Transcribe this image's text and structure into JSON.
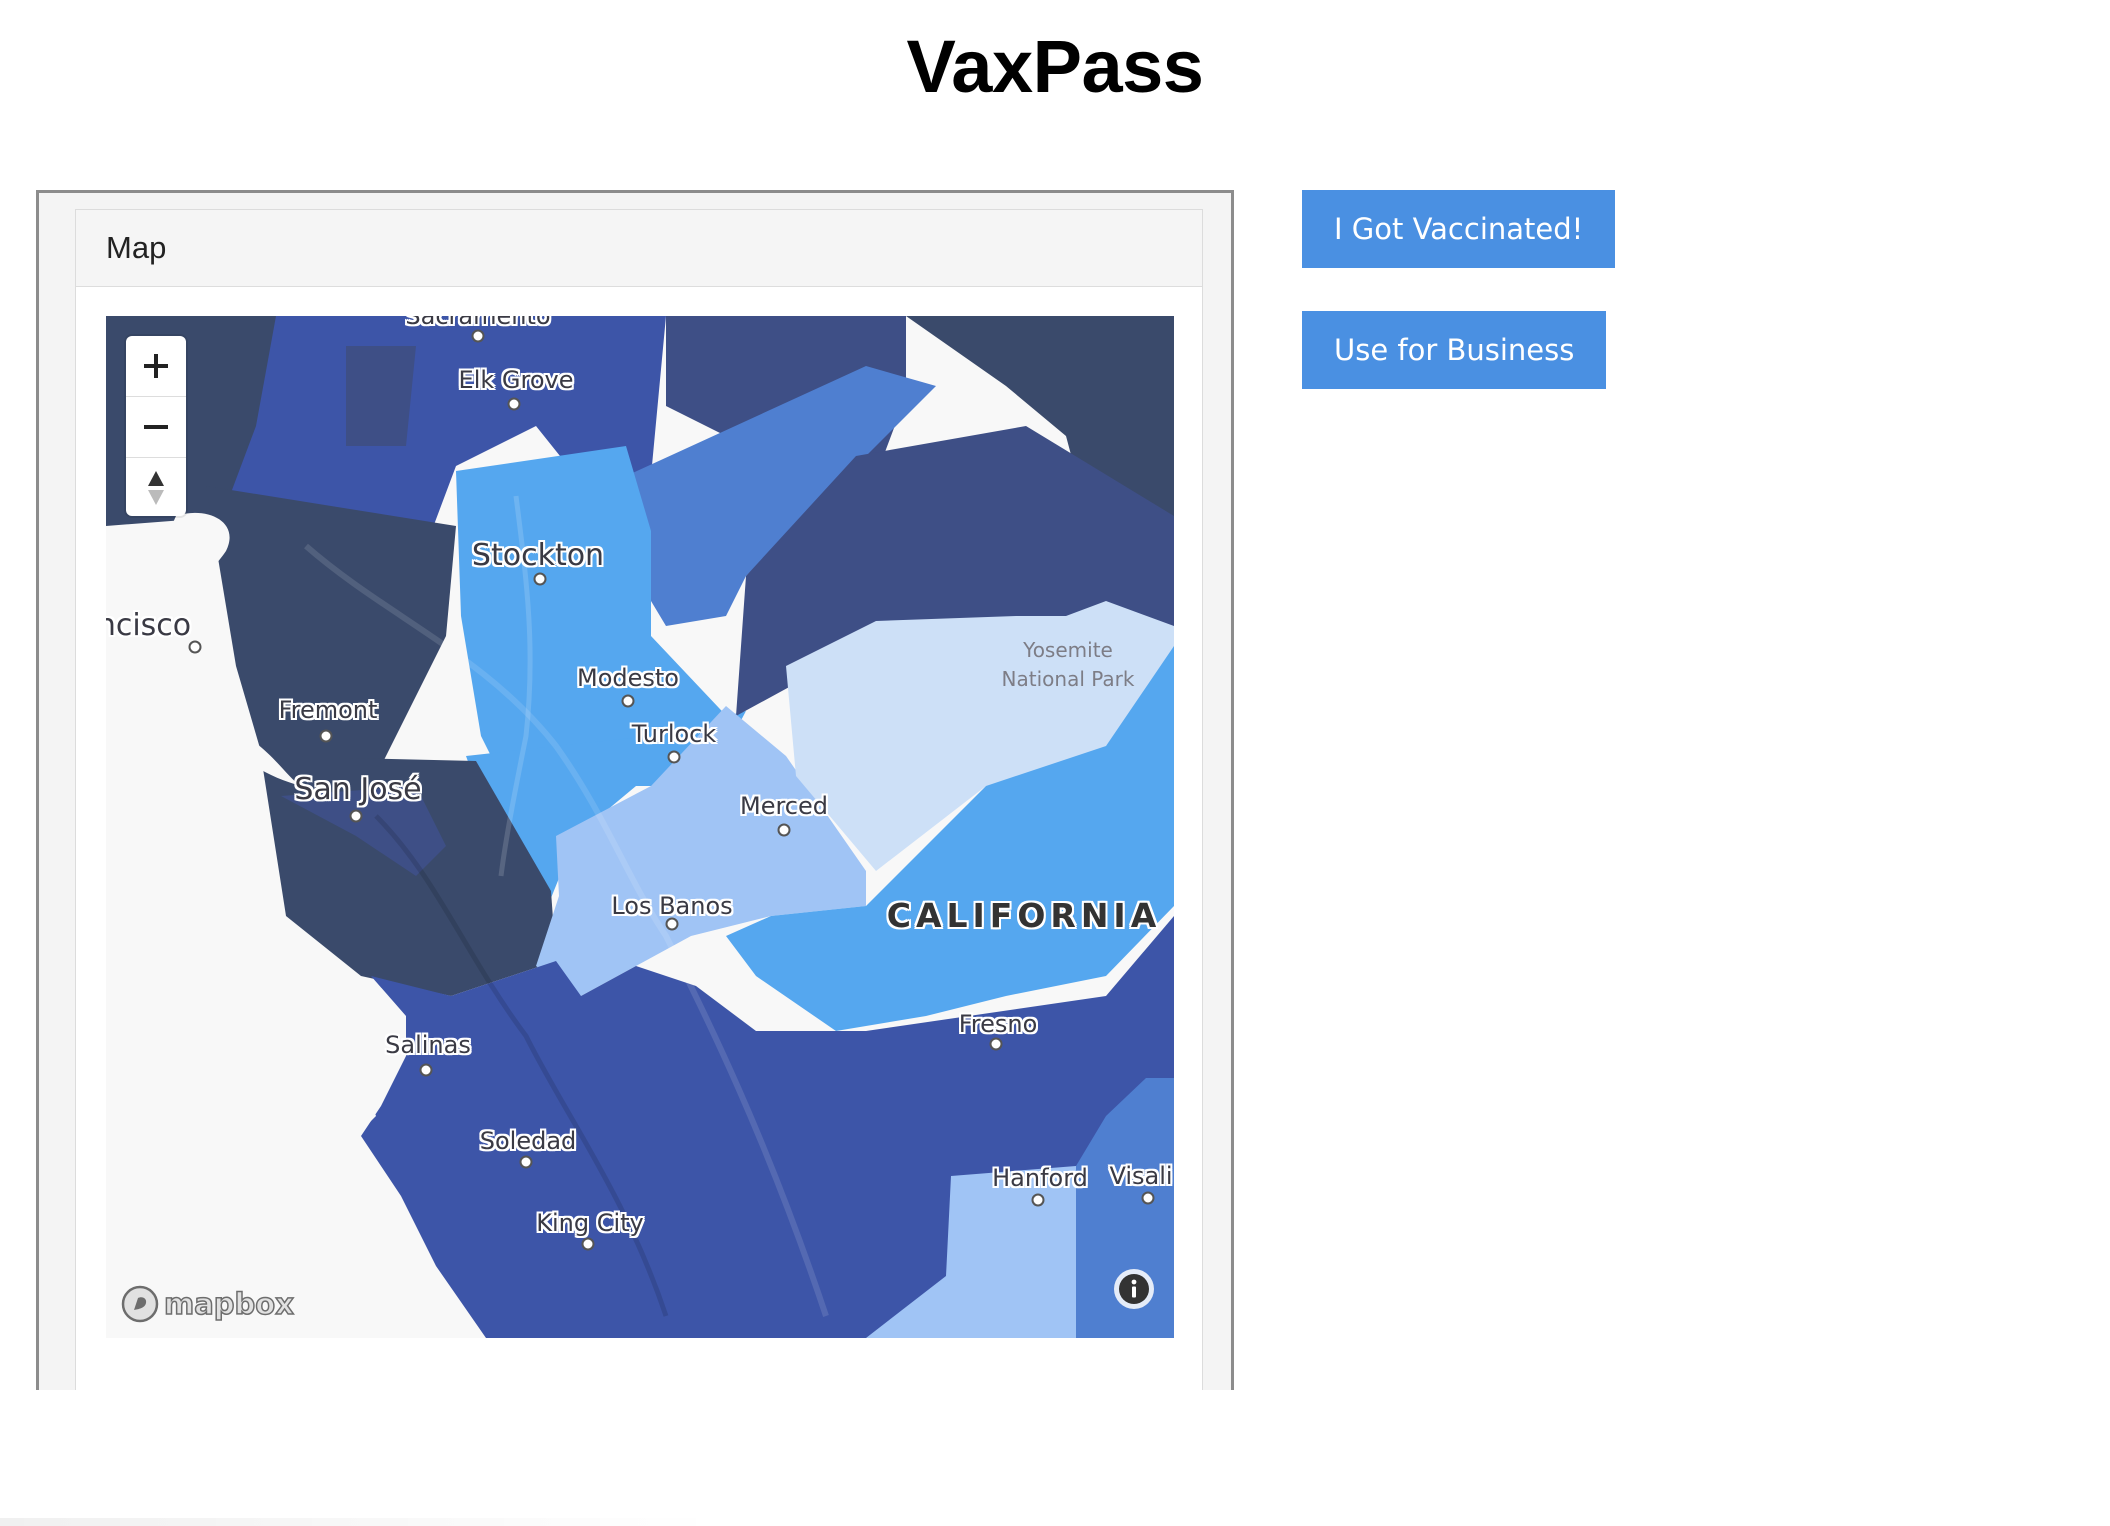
{
  "app": {
    "title": "VaxPass"
  },
  "panel": {
    "heading": "Map"
  },
  "map": {
    "zoom_in_label": "+",
    "zoom_out_label": "−",
    "labels": {
      "sacramento": "Sacramento",
      "elk_grove": "Elk Grove",
      "stockton": "Stockton",
      "san_francisco": "ncisco",
      "modesto": "Modesto",
      "turlock": "Turlock",
      "fremont": "Fremont",
      "san_jose": "San José",
      "merced": "Merced",
      "yosemite_line1": "Yosemite",
      "yosemite_line2": "National Park",
      "los_banos": "Los Banos",
      "california": "CALIFORNIA",
      "salinas": "Salinas",
      "fresno": "Fresno",
      "soledad": "Soledad",
      "hanford": "Hanford",
      "visalia": "Visali",
      "king_city": "King City"
    },
    "attribution": "mapbox",
    "colors": {
      "darkest": "#3a4a6b",
      "dark_navy": "#3e4f86",
      "royal": "#3d55a8",
      "medium": "#4f7fd0",
      "bright": "#55a7ef",
      "light": "#a0c4f5",
      "palest": "#cde0f7",
      "land": "#f8f8f8"
    }
  },
  "buttons": {
    "vaccinated": "I Got Vaccinated!",
    "business": "Use for Business"
  },
  "accent_color": "#4a90e2"
}
